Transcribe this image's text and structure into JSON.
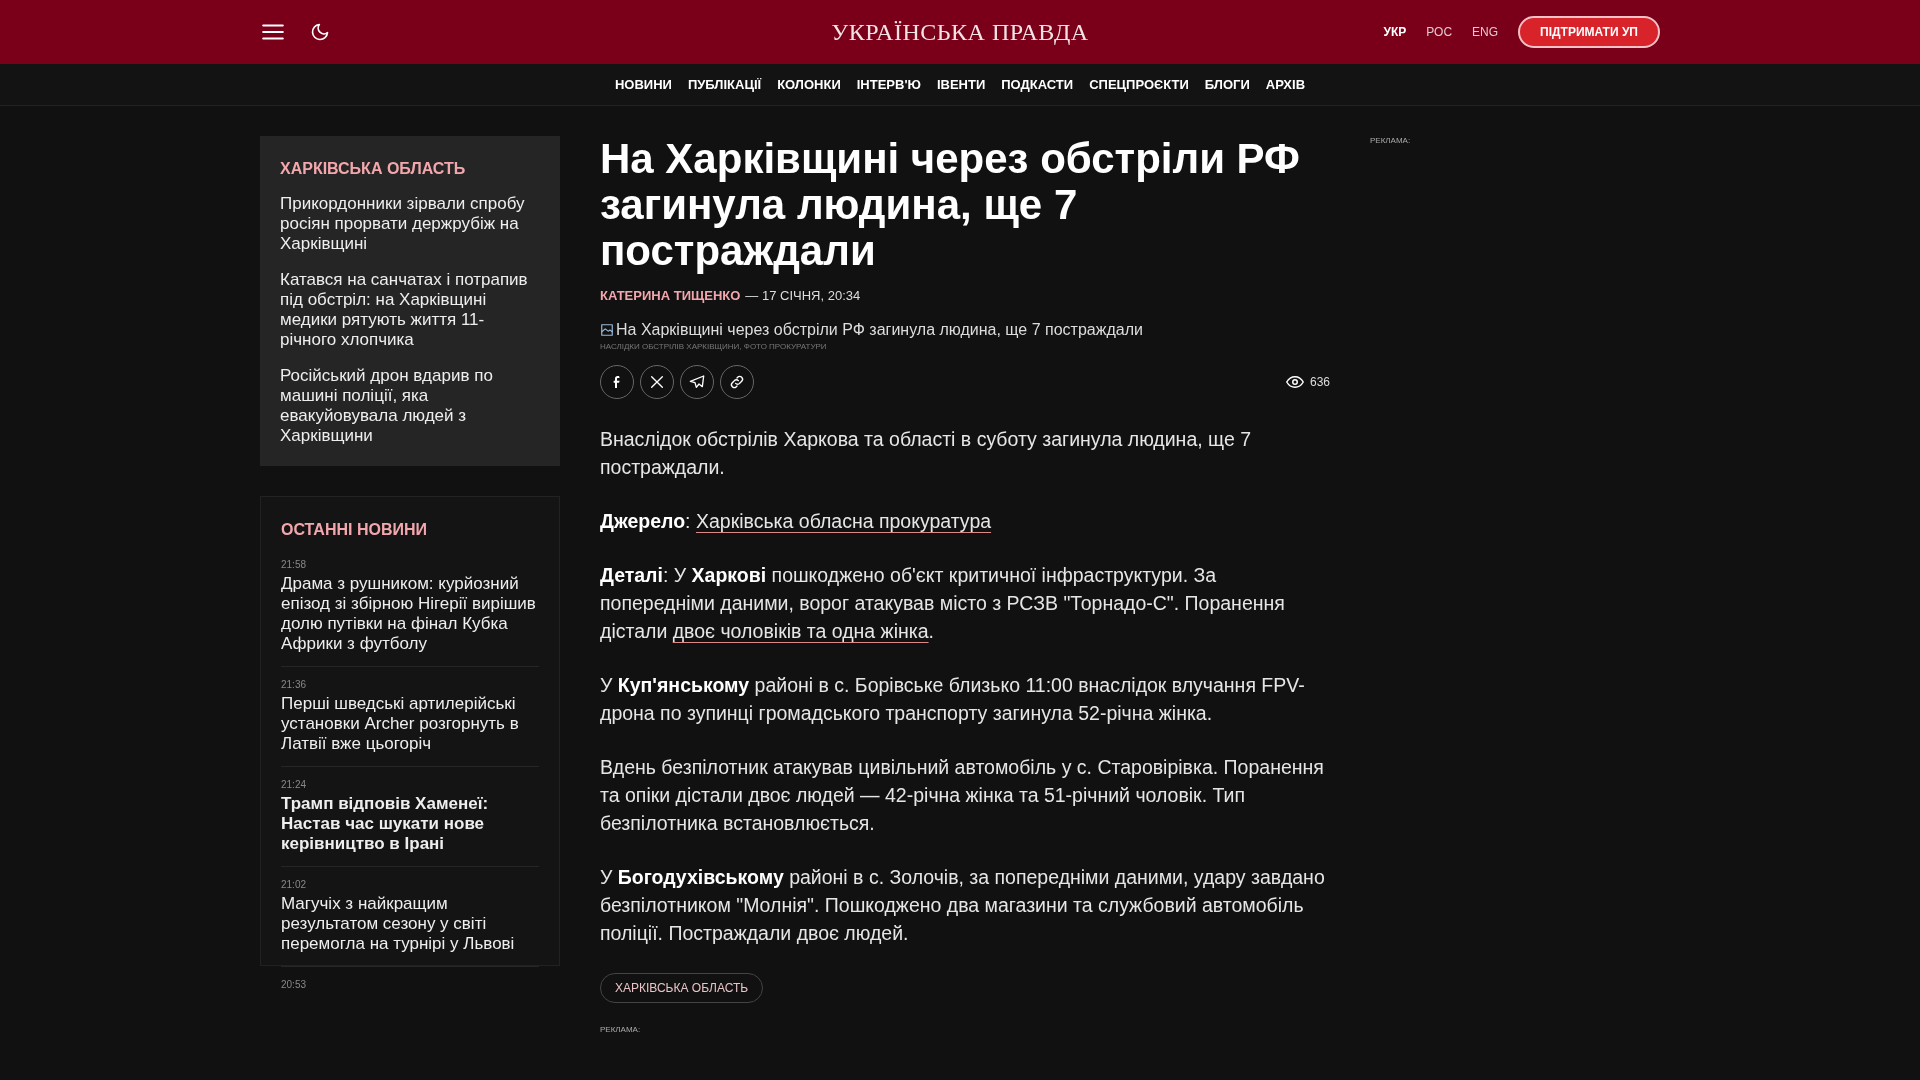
{
  "header": {
    "logo": "УКРАЇНСЬКА ПРАВДА",
    "languages": [
      {
        "label": "УКР",
        "selected": true
      },
      {
        "label": "РОС",
        "selected": false
      },
      {
        "label": "ENG",
        "selected": false
      }
    ],
    "support_button": "ПІДТРИМАТИ УП"
  },
  "nav": [
    "НОВИНИ",
    "ПУБЛІКАЦІЇ",
    "КОЛОНКИ",
    "ІНТЕРВ'Ю",
    "ІВЕНТИ",
    "ПОДКАСТИ",
    "СПЕЦПРОЄКТИ",
    "БЛОГИ",
    "АРХІВ"
  ],
  "region_box": {
    "title": "ХАРКІВСЬКА ОБЛАСТЬ",
    "items": [
      "Прикордонники зірвали спробу росіян прорвати держрубіж на Харківщині",
      "Катався на санчатах і потрапив під обстріл: на Харківщині медики рятують життя 11-річного хлопчика",
      "Російський дрон вдарив по машині поліції, яка евакуйовувала людей з Харківщини"
    ]
  },
  "latest_news": {
    "title": "ОСТАННІ НОВИНИ",
    "items": [
      {
        "time": "21:58",
        "title": "Драма з рушником: курйозний епізод зі збірною Нігерії вирішив долю путівки на фінал Кубка Африки з футболу",
        "important": false
      },
      {
        "time": "21:36",
        "title": "Перші шведські артилерійські установки Archer розгорнуть в Латвії вже цьогоріч",
        "important": false
      },
      {
        "time": "21:24",
        "title": "Трамп відповів Хаменеї: Настав час шукати нове керівництво в Ірані",
        "important": true
      },
      {
        "time": "21:02",
        "title": "Магучіх з найкращим результатом сезону у світі перемогла на турнірі у Львові",
        "important": false
      },
      {
        "time": "20:53"
      }
    ]
  },
  "article": {
    "title": "На Харківщині через обстріли РФ загинула людина, ще 7 постраждали",
    "author": "КАТЕРИНА ТИЩЕНКО",
    "date": "— 17 СІЧНЯ, 20:34",
    "image_alt": "На Харківщині через обстріли РФ загинула людина, ще 7 постраждали",
    "image_caption": "НАСЛІДКИ ОБСТРІЛІВ ХАРКІВЩИНИ, ФОТО ПРОКУРАТУРИ",
    "views": "636",
    "paragraphs": [
      [
        {
          "kind": "text",
          "text": "Внаслідок обстрілів Харкова та області в суботу загинула людина, ще 7 постраждали."
        }
      ],
      [
        {
          "kind": "text",
          "text": "**Джерело**: "
        },
        {
          "kind": "link",
          "text": "Харківська обласна прокуратура"
        }
      ],
      [
        {
          "kind": "text",
          "text": "**Деталі**: У **Харкові** пошкоджено об'єкт критичної інфраструктури. За попередніми даними, ворог атакував місто з РСЗВ \"Торнадо-С\". Поранення дістали "
        },
        {
          "kind": "link",
          "text": "двоє чоловіків та одна жінка"
        },
        {
          "kind": "text",
          "text": "."
        }
      ],
      [
        {
          "kind": "text",
          "text": "У **Куп'янському** районі в с. Борівське близько 11:00 внаслідок влучання FPV-дрона по зупинці громадського транспорту загинула 52-річна жінка."
        }
      ],
      [
        {
          "kind": "text",
          "text": "Вдень безпілотник атакував цивільний автомобіль у с. Старовірівка. Поранення та опіки дістали двоє людей — 42-річна жінка та 51-річний чоловік. Тип безпілотника встановлюється."
        }
      ],
      [
        {
          "kind": "text",
          "text": "У **Богодухівському** районі в с. Золочів, за попередніми даними, удару завдано безпілотником \"Молнія\". Пошкоджено два магазини та службовий автомобіль поліції. Постраждали двоє людей."
        }
      ]
    ],
    "tag": "ХАРКІВСЬКА ОБЛАСТЬ",
    "ad_label": "РЕКЛАМА:"
  },
  "right_ad_label": "РЕКЛАМА:"
}
